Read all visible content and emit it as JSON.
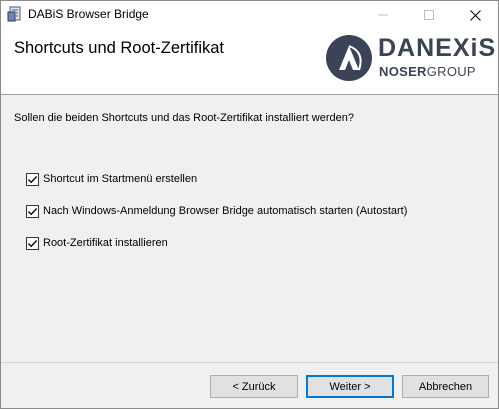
{
  "window": {
    "title": "DABiS Browser Bridge"
  },
  "banner": {
    "title": "Shortcuts und Root-Zertifikat",
    "logo": {
      "name": "DANEXiS",
      "sub_first": "NOSER",
      "sub_second": "GROUP"
    }
  },
  "content": {
    "question": "Sollen die beiden Shortcuts und das Root-Zertifikat installiert werden?",
    "options": [
      {
        "label": "Shortcut im Startmenü erstellen",
        "checked": true
      },
      {
        "label": "Nach Windows-Anmeldung Browser Bridge automatisch starten (Autostart)",
        "checked": true
      },
      {
        "label": "Root-Zertifikat installieren",
        "checked": true
      }
    ]
  },
  "buttons": {
    "back": "< Zurück",
    "next": "Weiter >",
    "cancel": "Abbrechen"
  },
  "colors": {
    "logo": "#3b4356",
    "focus_border": "#0078d7"
  }
}
